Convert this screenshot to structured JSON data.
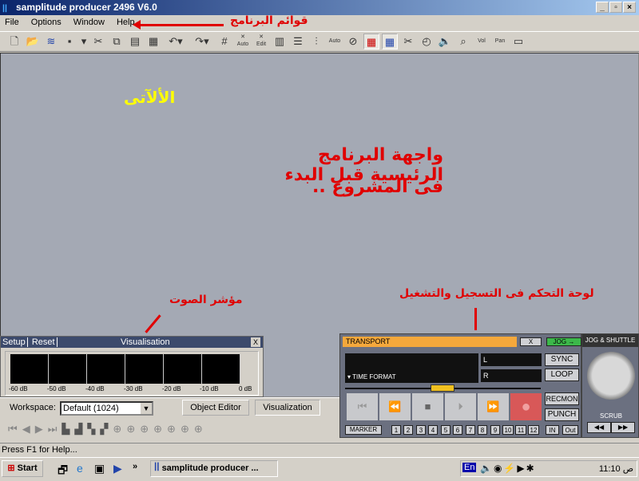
{
  "window": {
    "title": "samplitude producer 2496 V6.0",
    "controls": [
      "_",
      "▫",
      "×"
    ]
  },
  "menu": [
    "File",
    "Options",
    "Window",
    "Help"
  ],
  "toolbar_icons": [
    "new-icon",
    "open-icon",
    "import-icon",
    "save-icon",
    "cut-icon",
    "copy-icon",
    "paste-icon",
    "paste-special-icon",
    "undo-icon",
    "redo-icon",
    "snap-icon",
    "auto-crossfade-icon",
    "edit-crossfade-icon",
    "mixer-icon",
    "align-icon",
    "grid-icon",
    "auto-grid-icon",
    "settings-icon",
    "range-icon",
    "object-icon",
    "cut-tool-icon",
    "timer-icon",
    "speaker-icon",
    "zoom-icon",
    "volume-icon",
    "pan-icon",
    "window-icon"
  ],
  "toolbar_labels": {
    "auto": "Auto",
    "edit": "Edit",
    "vol": "Vol",
    "pan": "Pan"
  },
  "annotations": {
    "menus": "قوائم البرنامج",
    "tools": "الألآتى",
    "main_line1": "واجهة البرنامج الرئيسية قبل البدء",
    "main_line2": "فى المشروع ..",
    "meter": "مؤشر الصوت",
    "transport": "لوحة التحكم فى التسجيل والتشغيل"
  },
  "visualisation": {
    "setup": "Setup",
    "reset": "Reset",
    "title": "Visualisation",
    "close": "X",
    "scale": [
      "-60 dB",
      "-50 dB",
      "-40 dB",
      "-30 dB",
      "-20 dB",
      "-10 dB",
      "0 dB"
    ]
  },
  "workspace": {
    "label": "Workspace:",
    "value": "Default (1024)",
    "object_editor": "Object Editor",
    "visualization": "Visualization"
  },
  "status": "Press F1 for Help...",
  "taskbar": {
    "start": "Start",
    "task": "samplitude producer ...",
    "lang": "En",
    "clock": "11:10 ص",
    "chevron": "»"
  },
  "transport": {
    "title": "TRANSPORT",
    "close": "X",
    "jog": "JOG →",
    "time_format": "▾ TIME FORMAT",
    "l": "L",
    "r": "R",
    "sync": "SYNC",
    "loop": "LOOP",
    "recmon": "RECMON",
    "punch": "PUNCH",
    "marker": "MARKER",
    "markers": [
      "1",
      "2",
      "3",
      "4",
      "5",
      "6",
      "7",
      "8",
      "9",
      "10",
      "11",
      "12"
    ],
    "in": "IN",
    "out": "Out",
    "buttons": [
      "⏮",
      "⏪",
      "■",
      "⏵",
      "⏩",
      "●"
    ]
  },
  "jog_shuttle": {
    "title": "JOG & SHUTTLE",
    "scrub": "SCRUB",
    "rew": "◀◀",
    "fwd": "▶▶"
  },
  "colors": {
    "title_bar": "#0a246a",
    "annotation": "#e00000",
    "annotation_yellow": "#ffff00",
    "transport_header": "#f5a83c",
    "jog_button": "#3cb84a",
    "record": "#d85858"
  }
}
